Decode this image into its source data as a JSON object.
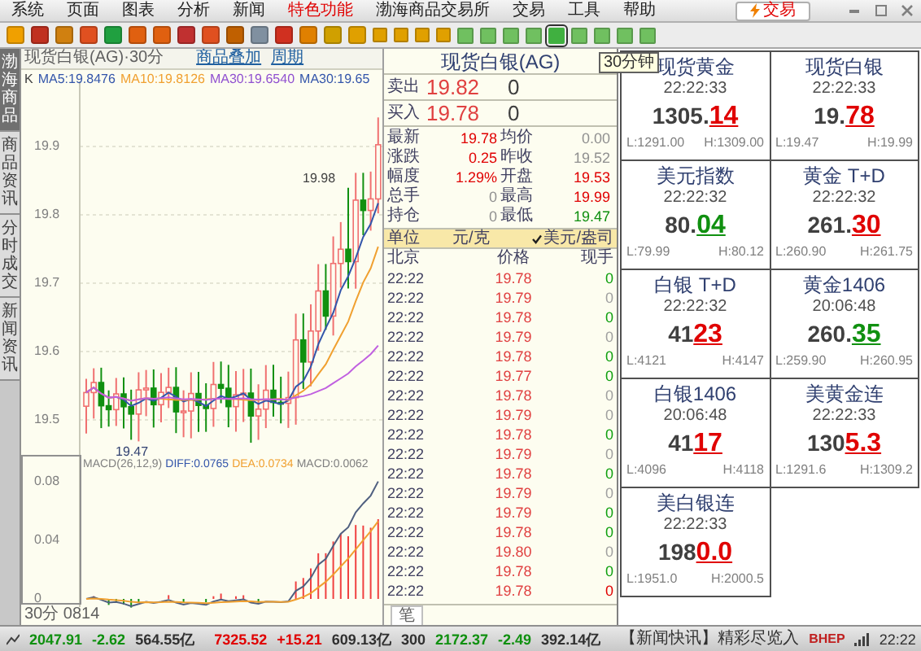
{
  "menu": [
    {
      "label": "系统",
      "highlighted": false
    },
    {
      "label": "页面",
      "highlighted": false
    },
    {
      "label": "图表",
      "highlighted": false
    },
    {
      "label": "分析",
      "highlighted": false
    },
    {
      "label": "新闻",
      "highlighted": false
    },
    {
      "label": "特色功能",
      "highlighted": true
    },
    {
      "label": "渤海商品交易所",
      "highlighted": false
    },
    {
      "label": "交易",
      "highlighted": false
    },
    {
      "label": "工具",
      "highlighted": false
    },
    {
      "label": "帮助",
      "highlighted": false
    }
  ],
  "trade_button": "交易",
  "toolbar": {
    "period_buttons": [
      {
        "selected": false
      },
      {
        "selected": false
      },
      {
        "selected": false
      },
      {
        "selected": false
      },
      {
        "selected": true
      },
      {
        "selected": false
      },
      {
        "selected": false
      },
      {
        "selected": false
      },
      {
        "selected": false
      }
    ],
    "tooltip": "30分钟"
  },
  "side_tabs": [
    {
      "label": "渤海商品",
      "selected": true
    },
    {
      "label": "商品资讯",
      "selected": false
    },
    {
      "label": "分时成交",
      "selected": false
    },
    {
      "label": "新闻资讯",
      "selected": false
    }
  ],
  "chart": {
    "title": "现货白银(AG)·30分",
    "buttons": [
      "商品叠加",
      "周期"
    ],
    "indicators": [
      {
        "label": "K",
        "color": "#404040"
      },
      {
        "label": "MA5:19.8476",
        "color": "#3355aa"
      },
      {
        "label": "MA10:19.8126",
        "color": "#f0a030"
      },
      {
        "label": "MA30:19.6540",
        "color": "#9050d0"
      },
      {
        "label": "MA30:19.65",
        "color": "#3355aa"
      }
    ],
    "y_labels": [
      "19.9",
      "19.8",
      "19.7",
      "19.6",
      "19.5"
    ],
    "high_label": "19.98",
    "low_label": "19.47",
    "macd_labels": [
      {
        "label": "MACD(26,12,9)",
        "color": "#808080"
      },
      {
        "label": "DIFF:0.0765",
        "color": "#3355aa"
      },
      {
        "label": "DEA:0.0734",
        "color": "#f0a030"
      },
      {
        "label": "MACD:0.0062",
        "color": "#808080"
      }
    ],
    "macd_y_labels": [
      "0.08",
      "0.04",
      "0"
    ],
    "x_label": "30分 0814"
  },
  "order_panel": {
    "title": "现货白银(AG)",
    "quotes": [
      {
        "label": "卖出",
        "price": "19.82",
        "volume": "0"
      },
      {
        "label": "买入",
        "price": "19.78",
        "volume": "0"
      }
    ],
    "stats": [
      {
        "label": "最新",
        "value": "19.78",
        "color": "#e00000"
      },
      {
        "label": "均价",
        "value": "0.00",
        "color": "#909090"
      },
      {
        "label": "涨跌",
        "value": "0.25",
        "color": "#e00000"
      },
      {
        "label": "昨收",
        "value": "19.52",
        "color": "#909090"
      },
      {
        "label": "幅度",
        "value": "1.29%",
        "color": "#e00000"
      },
      {
        "label": "开盘",
        "value": "19.53",
        "color": "#e00000"
      },
      {
        "label": "总手",
        "value": "0",
        "color": "#909090"
      },
      {
        "label": "最高",
        "value": "19.99",
        "color": "#e00000"
      },
      {
        "label": "持仓",
        "value": "0",
        "color": "#909090"
      },
      {
        "label": "最低",
        "value": "19.47",
        "color": "#109010"
      }
    ],
    "unit_label": "单位",
    "unit": "元/克",
    "unit_option": {
      "label": "美元/盎司",
      "checked": true
    },
    "trade_headers": [
      "北京",
      "价格",
      "现手"
    ],
    "trades": [
      {
        "time": "22:22",
        "price": "19.78",
        "volume": "0",
        "color": "#10a010"
      },
      {
        "time": "22:22",
        "price": "19.79",
        "volume": "0",
        "color": "#a0a0a0"
      },
      {
        "time": "22:22",
        "price": "19.78",
        "volume": "0",
        "color": "#10a010"
      },
      {
        "time": "22:22",
        "price": "19.79",
        "volume": "0",
        "color": "#a0a0a0"
      },
      {
        "time": "22:22",
        "price": "19.78",
        "volume": "0",
        "color": "#10a010"
      },
      {
        "time": "22:22",
        "price": "19.77",
        "volume": "0",
        "color": "#10a010"
      },
      {
        "time": "22:22",
        "price": "19.78",
        "volume": "0",
        "color": "#a0a0a0"
      },
      {
        "time": "22:22",
        "price": "19.79",
        "volume": "0",
        "color": "#a0a0a0"
      },
      {
        "time": "22:22",
        "price": "19.78",
        "volume": "0",
        "color": "#10a010"
      },
      {
        "time": "22:22",
        "price": "19.79",
        "volume": "0",
        "color": "#a0a0a0"
      },
      {
        "time": "22:22",
        "price": "19.78",
        "volume": "0",
        "color": "#10a010"
      },
      {
        "time": "22:22",
        "price": "19.79",
        "volume": "0",
        "color": "#a0a0a0"
      },
      {
        "time": "22:22",
        "price": "19.79",
        "volume": "0",
        "color": "#10a010"
      },
      {
        "time": "22:22",
        "price": "19.78",
        "volume": "0",
        "color": "#10a010"
      },
      {
        "time": "22:22",
        "price": "19.80",
        "volume": "0",
        "color": "#a0a0a0"
      },
      {
        "time": "22:22",
        "price": "19.78",
        "volume": "0",
        "color": "#10a010"
      },
      {
        "time": "22:22",
        "price": "19.78",
        "volume": "0",
        "color": "#e00000"
      }
    ],
    "footer_tab": "笔"
  },
  "quotes_grid": [
    {
      "name": "现货黄金",
      "time": "22:22:33",
      "price_main": "1305.",
      "price_tail": "14",
      "color": "#e00000",
      "low": "L:1291.00",
      "high": "H:1309.00"
    },
    {
      "name": "现货白银",
      "time": "22:22:33",
      "price_main": "19.",
      "price_tail": "78",
      "color": "#e00000",
      "low": "L:19.47",
      "high": "H:19.99"
    },
    {
      "name": "美元指数",
      "time": "22:22:32",
      "price_main": "80.",
      "price_tail": "04",
      "color": "#109010",
      "low": "L:79.99",
      "high": "H:80.12"
    },
    {
      "name": "黄金 T+D",
      "time": "22:22:32",
      "price_main": "261.",
      "price_tail": "30",
      "color": "#e00000",
      "low": "L:260.90",
      "high": "H:261.75"
    },
    {
      "name": "白银 T+D",
      "time": "22:22:32",
      "price_main": "41",
      "price_tail": "23",
      "color": "#e00000",
      "low": "L:4121",
      "high": "H:4147"
    },
    {
      "name": "黄金1406",
      "time": "20:06:48",
      "price_main": "260.",
      "price_tail": "35",
      "color": "#109010",
      "low": "L:259.90",
      "high": "H:260.95"
    },
    {
      "name": "白银1406",
      "time": "20:06:48",
      "price_main": "41",
      "price_tail": "17",
      "color": "#e00000",
      "low": "L:4096",
      "high": "H:4118"
    },
    {
      "name": "美黄金连",
      "time": "22:22:33",
      "price_main": "130",
      "price_tail": "5.3",
      "color": "#e00000",
      "low": "L:1291.6",
      "high": "H:1309.2"
    },
    {
      "name": "美白银连",
      "time": "22:22:33",
      "price_main": "198",
      "price_tail": "0.0",
      "color": "#e00000",
      "low": "L:1951.0",
      "high": "H:2000.5"
    }
  ],
  "status_bar": [
    {
      "text": "2047.91",
      "color": "#109010"
    },
    {
      "text": "-2.62",
      "color": "#109010"
    },
    {
      "text": "564.55亿",
      "color": "#303030"
    },
    {
      "text": "7325.52",
      "color": "#e00000"
    },
    {
      "text": "+15.21",
      "color": "#e00000"
    },
    {
      "text": "609.13亿",
      "color": "#303030"
    },
    {
      "text": "300",
      "color": "#303030"
    },
    {
      "text": "2172.37",
      "color": "#109010"
    },
    {
      "text": "-2.49",
      "color": "#109010"
    },
    {
      "text": "392.14亿",
      "color": "#303030"
    }
  ],
  "news_ticker": "【新闻快讯】精彩尽览入",
  "brand": "BHEP",
  "clock": "22:22"
}
